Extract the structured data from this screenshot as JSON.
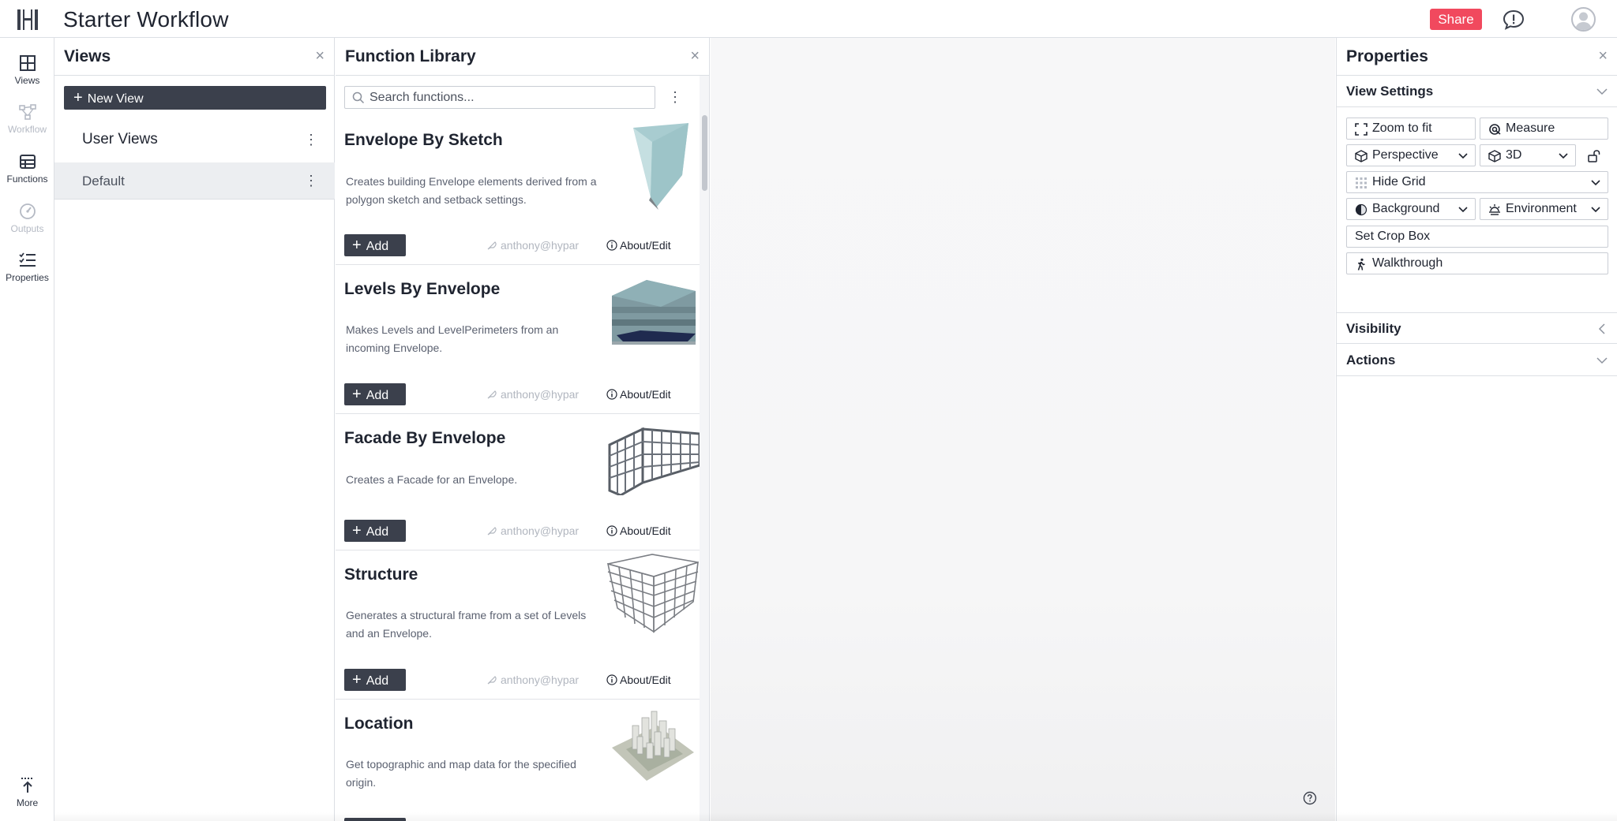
{
  "header": {
    "title": "Starter Workflow",
    "share_label": "Share"
  },
  "rail": {
    "items": [
      {
        "label": "Views",
        "icon": "grid-icon",
        "state": "active"
      },
      {
        "label": "Workflow",
        "icon": "workflow-icon",
        "state": "disabled"
      },
      {
        "label": "Functions",
        "icon": "functions-icon",
        "state": "active"
      },
      {
        "label": "Outputs",
        "icon": "gauge-icon",
        "state": "disabled"
      },
      {
        "label": "Properties",
        "icon": "list-check-icon",
        "state": "active"
      }
    ],
    "more_label": "More"
  },
  "views": {
    "title": "Views",
    "new_view_label": "New View",
    "group_label": "User Views",
    "items": [
      {
        "label": "Default",
        "selected": true
      }
    ]
  },
  "library": {
    "title": "Function Library",
    "search_placeholder": "Search functions...",
    "add_label": "Add",
    "about_label": "About/Edit",
    "cards": [
      {
        "title": "Envelope By Sketch",
        "desc": "Creates building Envelope elements derived from a polygon sketch and setback settings.",
        "author": "anthony@hypar"
      },
      {
        "title": "Levels By Envelope",
        "desc": "Makes Levels and LevelPerimeters from an incoming Envelope.",
        "author": "anthony@hypar"
      },
      {
        "title": "Facade By Envelope",
        "desc": "Creates a Facade for an Envelope.",
        "author": "anthony@hypar"
      },
      {
        "title": "Structure",
        "desc": "Generates a structural frame from a set of Levels and an Envelope.",
        "author": "anthony@hypar"
      },
      {
        "title": "Location",
        "desc": "Get topographic and map data for the specified origin.",
        "author": "anthony@hypar"
      }
    ]
  },
  "properties": {
    "title": "Properties",
    "view_settings_label": "View Settings",
    "buttons": {
      "zoom": "Zoom to fit",
      "measure": "Measure",
      "perspective": "Perspective",
      "mode3d": "3D",
      "grid": "Hide Grid",
      "background": "Background",
      "environment": "Environment",
      "crop": "Set Crop Box",
      "walk": "Walkthrough"
    },
    "visibility_label": "Visibility",
    "actions_label": "Actions"
  },
  "colors": {
    "accent_share": "#f1495e",
    "dark_button": "#3b404c"
  }
}
